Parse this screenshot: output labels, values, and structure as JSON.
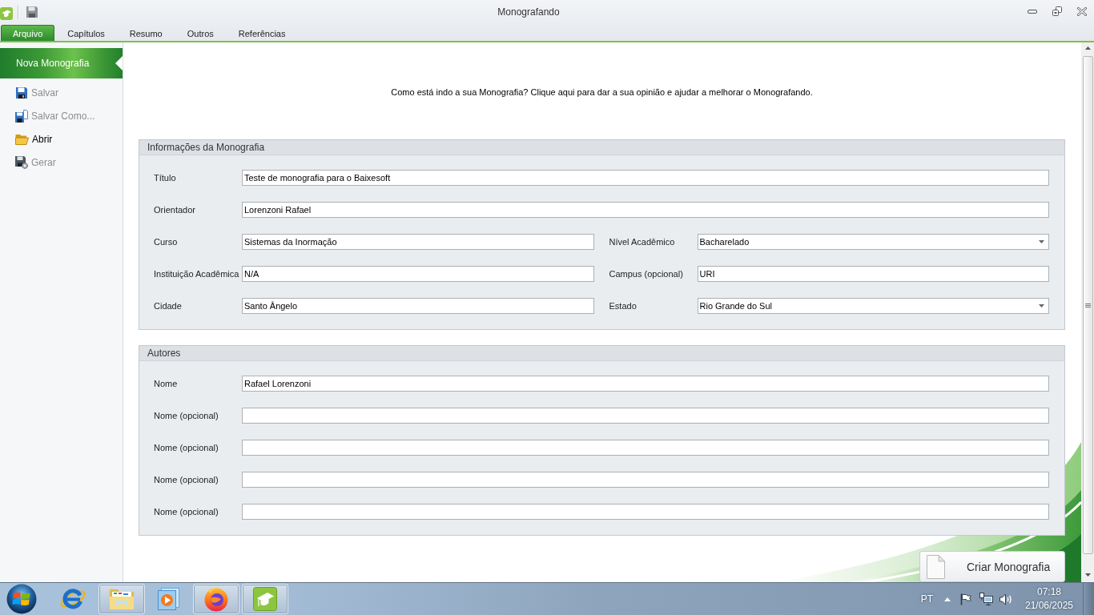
{
  "window": {
    "title": "Monografando"
  },
  "ribbon_tabs": [
    {
      "label": "Arquivo",
      "selected": true
    },
    {
      "label": "Capítulos",
      "selected": false
    },
    {
      "label": "Resumo",
      "selected": false
    },
    {
      "label": "Outros",
      "selected": false
    },
    {
      "label": "Referências",
      "selected": false
    }
  ],
  "sidebar": {
    "header": "Nova Monografia",
    "items": [
      {
        "label": "Salvar",
        "disabled": true
      },
      {
        "label": "Salvar Como...",
        "disabled": true
      },
      {
        "label": "Abrir",
        "disabled": false
      },
      {
        "label": "Gerar",
        "disabled": true
      }
    ]
  },
  "feedback_link": "Como está indo a sua Monografia? Clique aqui para dar a sua opinião e ajudar a melhorar o Monografando.",
  "info_group": {
    "title": "Informações da Monografia",
    "rows": [
      {
        "fields": [
          {
            "label": "Título",
            "kind": "text",
            "value": "Teste de monografia para o Baixesoft"
          }
        ]
      },
      {
        "fields": [
          {
            "label": "Orientador",
            "kind": "text",
            "value": "Lorenzoni Rafael"
          }
        ]
      },
      {
        "fields": [
          {
            "label": "Curso",
            "kind": "text",
            "value": "Sistemas da Inormação"
          },
          {
            "label": "Nível Acadêmico",
            "kind": "dropdown",
            "value": "Bacharelado"
          }
        ]
      },
      {
        "fields": [
          {
            "label": "Instituição Acadêmica",
            "kind": "text",
            "value": "N/A"
          },
          {
            "label": "Campus (opcional)",
            "kind": "text",
            "value": "URI"
          }
        ]
      },
      {
        "fields": [
          {
            "label": "Cidade",
            "kind": "text",
            "value": "Santo Ângelo"
          },
          {
            "label": "Estado",
            "kind": "dropdown",
            "value": "Rio Grande do Sul"
          }
        ]
      }
    ]
  },
  "authors_group": {
    "title": "Autores",
    "rows": [
      {
        "fields": [
          {
            "label": "Nome",
            "kind": "text",
            "value": "Rafael Lorenzoni"
          }
        ]
      },
      {
        "fields": [
          {
            "label": "Nome (opcional)",
            "kind": "text"
          }
        ]
      },
      {
        "fields": [
          {
            "label": "Nome (opcional)",
            "kind": "text"
          }
        ]
      },
      {
        "fields": [
          {
            "label": "Nome (opcional)",
            "kind": "text"
          }
        ]
      },
      {
        "fields": [
          {
            "label": "Nome (opcional)",
            "kind": "text"
          }
        ]
      }
    ]
  },
  "create_button": {
    "label": "Criar Monografia"
  },
  "taskbar": {
    "buttons": [
      {
        "open": false
      },
      {
        "open": true
      },
      {
        "open": false
      },
      {
        "open": true
      },
      {
        "open": true
      }
    ],
    "language": "PT",
    "time": "07:18",
    "date": "21/06/2025"
  }
}
